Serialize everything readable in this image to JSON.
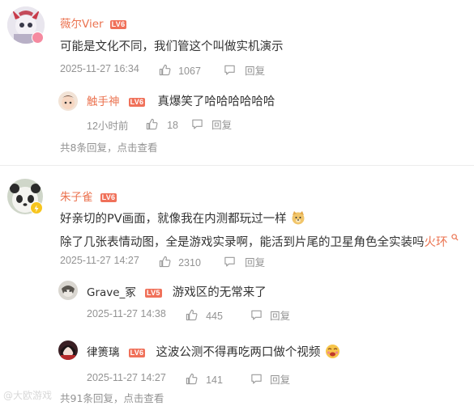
{
  "comments": [
    {
      "username": "薇尔Vier",
      "level": "LV6",
      "text": "可能是文化不同，我们管这个叫做实机演示",
      "time": "2025-11-27 16:34",
      "likes": "1067",
      "reply_label": "回复",
      "replies": [
        {
          "username": "触手神",
          "level": "LV6",
          "text": "真爆笑了哈哈哈哈哈哈",
          "time": "12小时前",
          "likes": "18",
          "reply_label": "回复"
        }
      ],
      "more_replies": "共8条回复，点击查看"
    },
    {
      "username": "朱子雀",
      "level": "LV6",
      "text_line1": "好亲切的PV画面，就像我在内测都玩过一样",
      "text_line2": "除了几张表情动图，全是游戏实录啊，能活到片尾的卫星角色全实装吗",
      "link_text": "火环",
      "time": "2025-11-27 14:27",
      "likes": "2310",
      "reply_label": "回复",
      "replies": [
        {
          "username": "Grave_冢",
          "level": "LV5",
          "text": "游戏区的无常来了",
          "time": "2025-11-27 14:38",
          "likes": "445",
          "reply_label": "回复"
        },
        {
          "username": "律箦璃",
          "level": "LV6",
          "text": "这波公测不得再吃两口做个视频",
          "time": "2025-11-27 14:27",
          "likes": "141",
          "reply_label": "回复"
        }
      ],
      "more_replies": "共91条回复，点击查看"
    }
  ],
  "watermark": "@大欧游戏",
  "colors": {
    "username": "#eb7350",
    "level_badge": "#f0715a",
    "meta": "#939393",
    "text": "#333333",
    "divider": "#ececec"
  }
}
